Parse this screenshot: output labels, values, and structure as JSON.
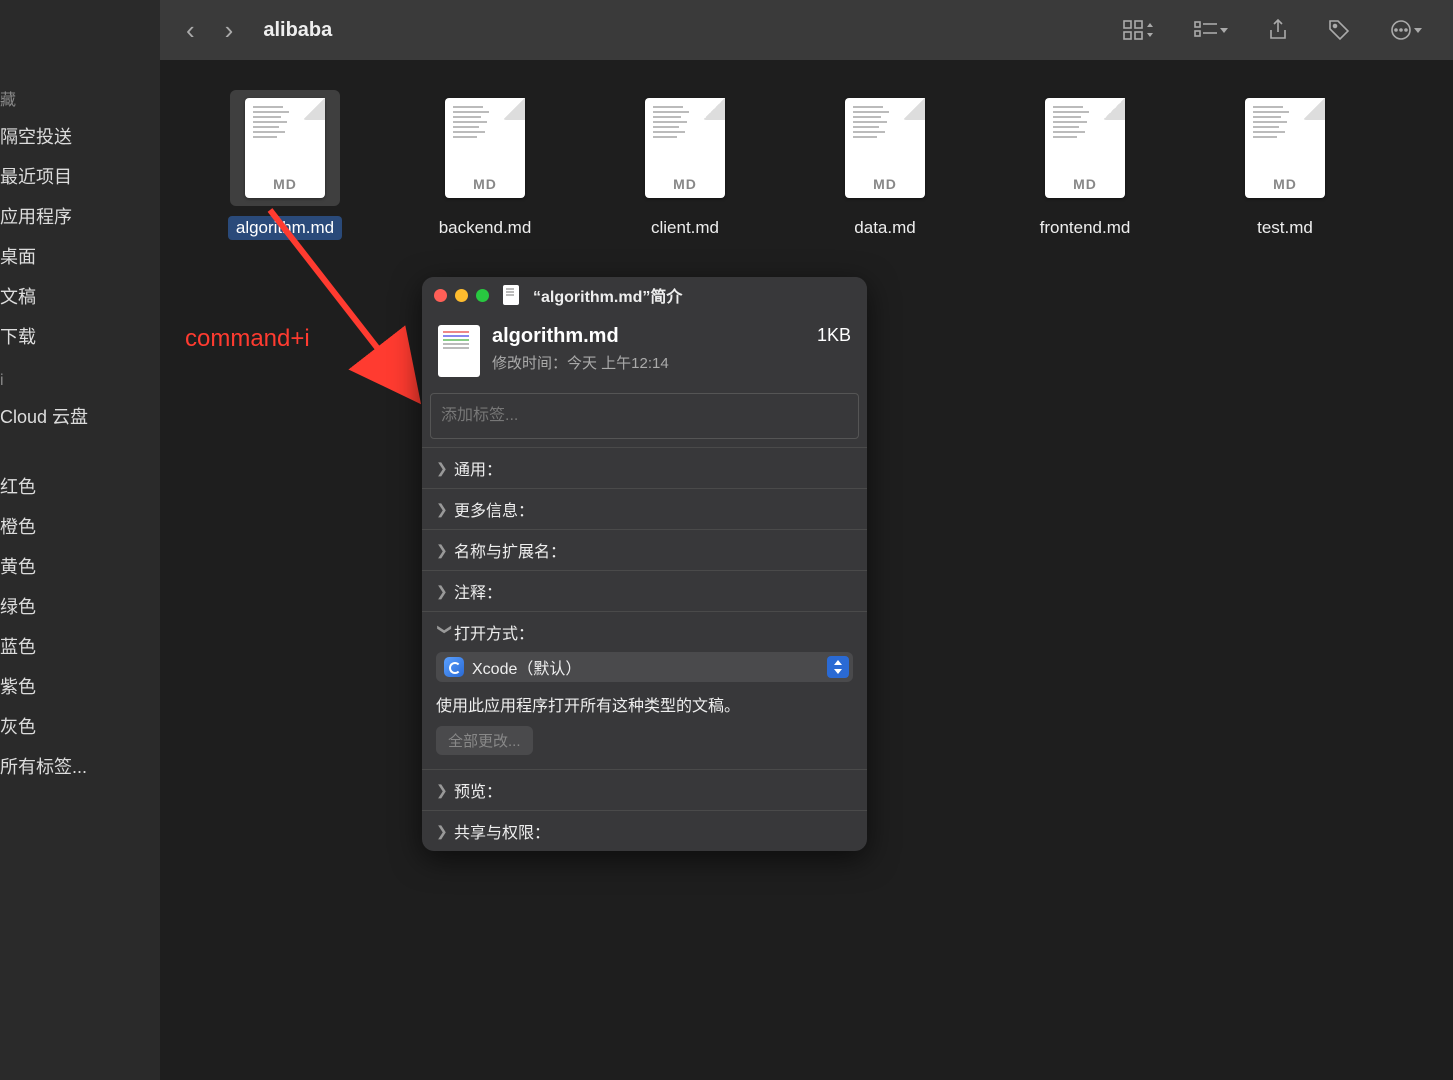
{
  "toolbar": {
    "folder": "alibaba"
  },
  "sidebar": {
    "favorites_header": "藏",
    "items": [
      "隔空投送",
      "最近项目",
      "应用程序",
      "桌面",
      "文稿",
      "下载"
    ],
    "icloud_header": "",
    "icloud_items": [
      "Cloud 云盘"
    ],
    "tags_header": "",
    "tags": [
      "红色",
      "橙色",
      "黄色",
      "绿色",
      "蓝色",
      "紫色",
      "灰色",
      "所有标签..."
    ]
  },
  "files": {
    "badge": "MD",
    "items": [
      {
        "name": "algorithm.md",
        "selected": true
      },
      {
        "name": "backend.md",
        "selected": false
      },
      {
        "name": "client.md",
        "selected": false
      },
      {
        "name": "data.md",
        "selected": false
      },
      {
        "name": "frontend.md",
        "selected": false
      },
      {
        "name": "test.md",
        "selected": false
      }
    ]
  },
  "annotation": {
    "text": "command+i"
  },
  "info": {
    "title": "“algorithm.md”简介",
    "filename": "algorithm.md",
    "modified_label": "修改时间：",
    "modified_value": "今天 上午12:14",
    "size": "1KB",
    "tags_placeholder": "添加标签...",
    "sections": {
      "general": "通用：",
      "more_info": "更多信息：",
      "name_ext": "名称与扩展名：",
      "comments": "注释：",
      "open_with": "打开方式：",
      "preview": "预览：",
      "sharing": "共享与权限："
    },
    "open_with": {
      "app": "Xcode",
      "default_suffix": "（默认）",
      "desc": "使用此应用程序打开所有这种类型的文稿。",
      "change_all": "全部更改..."
    }
  }
}
